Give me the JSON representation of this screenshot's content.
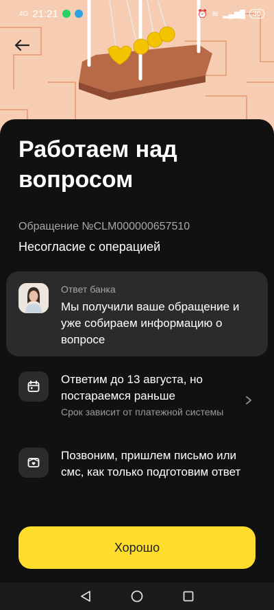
{
  "status_bar": {
    "time": "21:21",
    "battery": "36",
    "signal": "4G"
  },
  "header": {
    "back_icon": "arrow-left-icon"
  },
  "page": {
    "title": "Работаем над вопросом",
    "case_number": "Обращение №CLM000000657510",
    "case_subject": "Несогласие с операцией"
  },
  "bank_response": {
    "label": "Ответ банка",
    "text": "Мы получили ваше обращение и уже собираем информацию о вопросе"
  },
  "info_items": [
    {
      "icon": "calendar-icon",
      "title": "Ответим до 13 августа, но постараемся раньше",
      "subtitle": "Срок зависит от платежной системы"
    },
    {
      "icon": "envelope-icon",
      "title": "Позвоним, пришлем письмо или смс, как только подготовим ответ"
    }
  ],
  "actions": {
    "ok_label": "Хорошо"
  },
  "colors": {
    "accent": "#ffdd2d",
    "background": "#111111",
    "card": "#2b2b2b",
    "hero": "#f6cdb3"
  }
}
